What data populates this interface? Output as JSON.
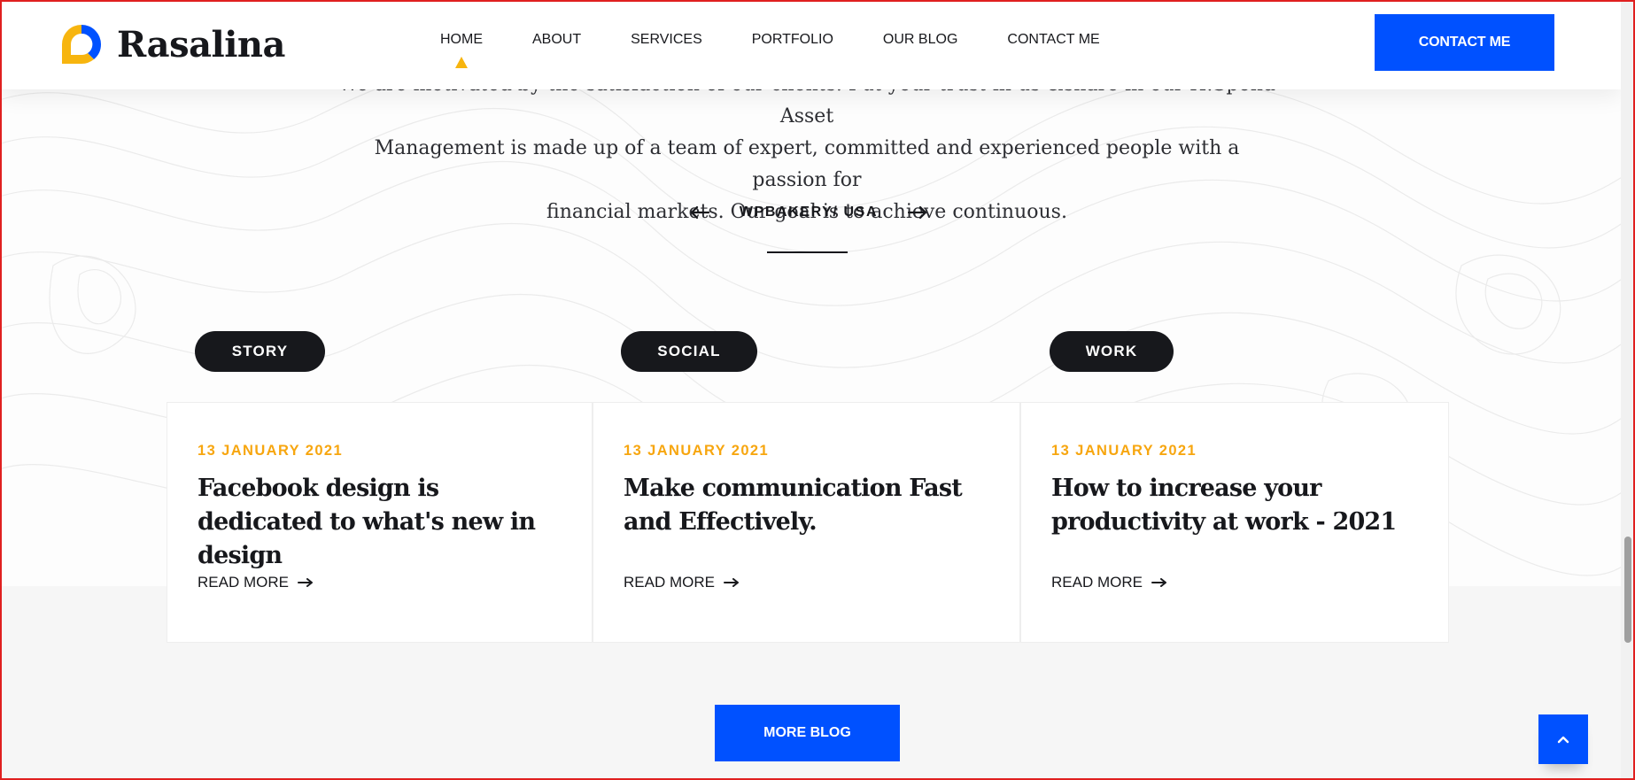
{
  "header": {
    "brand": "Rasalina",
    "nav": [
      "HOME",
      "ABOUT",
      "SERVICES",
      "PORTFOLIO",
      "OUR BLOG",
      "CONTACT ME"
    ],
    "active_nav": "HOME",
    "cta_label": "CONTACT ME"
  },
  "testimonial": {
    "line1": "We are motivated by the satisfaction of our clients. Put your trust in us &share in our H.Spond Asset",
    "line2": "Management is made up of a team of expert, committed and experienced people with a passion for",
    "line3": "financial markets. Our goal is to achieve continuous.",
    "author": "WPBAKERY/ USA"
  },
  "blog": {
    "cards": [
      {
        "tag": "STORY",
        "date": "13 JANUARY 2021",
        "title": "Facebook design is dedicated to what's new in design",
        "read_more": "READ MORE"
      },
      {
        "tag": "SOCIAL",
        "date": "13 JANUARY 2021",
        "title": "Make communication Fast and Effectively.",
        "read_more": "READ MORE"
      },
      {
        "tag": "WORK",
        "date": "13 JANUARY 2021",
        "title": "How to increase your productivity at work - 2021",
        "read_more": "READ MORE"
      }
    ],
    "more_label": "MORE BLOG"
  },
  "colors": {
    "accent_blue": "#0051ff",
    "accent_yellow": "#f7b50f",
    "dark": "#17181c"
  },
  "icons": {
    "logo": "rasalina-logo-icon",
    "prev": "arrow-left-icon",
    "next": "arrow-right-icon",
    "read_more": "long-arrow-right-icon",
    "to_top": "chevron-up-icon"
  }
}
